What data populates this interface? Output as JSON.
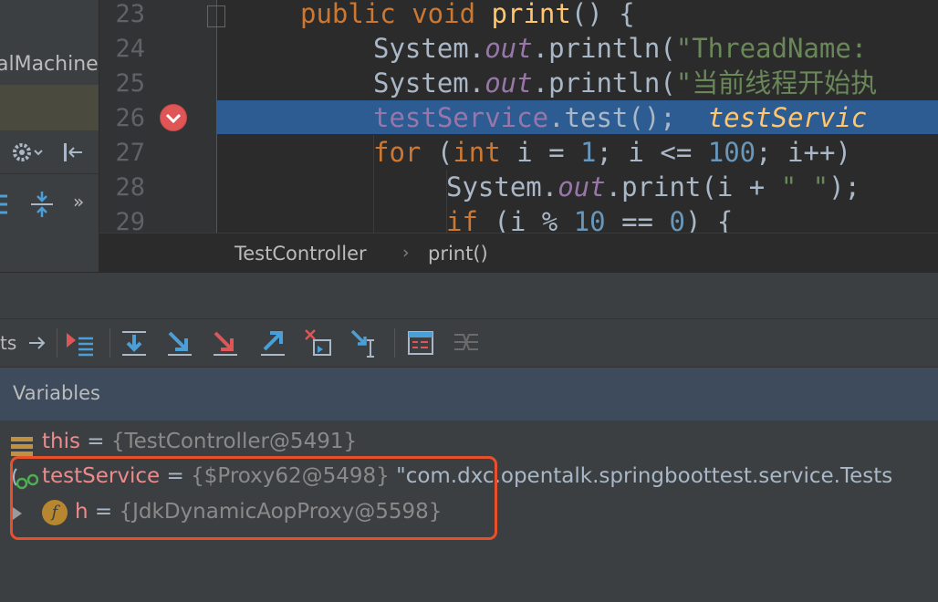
{
  "left_panel": {
    "label": "alMachine"
  },
  "editor": {
    "lines": [
      {
        "num": "23"
      },
      {
        "num": "24"
      },
      {
        "num": "25"
      },
      {
        "num": "26"
      },
      {
        "num": "27"
      },
      {
        "num": "28"
      },
      {
        "num": "29"
      }
    ],
    "code": {
      "l23_kw": "public void",
      "l23_fn": "print",
      "l23_rest": "() {",
      "l24_a": "System.",
      "l24_fld": "out",
      "l24_b": ".println(",
      "l24_str": "\"ThreadName:",
      "l25_a": "System.",
      "l25_fld": "out",
      "l25_b": ".println(",
      "l25_str": "\"当前线程开始执",
      "l26_fld": "testService",
      "l26_b": ".test();",
      "l26_inline": "testServic",
      "l27_kw": "for",
      "l27_a": "(",
      "l27_kw2": "int",
      "l27_b": "i =",
      "l27_n1": "1",
      "l27_c": "; i <=",
      "l27_n2": "100",
      "l27_d": "; i++)",
      "l28_a": "System.",
      "l28_fld": "out",
      "l28_b": ".print(i +",
      "l28_str": "\" \"",
      "l28_c": ");",
      "l29_kw": "if",
      "l29_a": "(i %",
      "l29_n1": "10",
      "l29_b": "==",
      "l29_n2": "0",
      "l29_c": ") {"
    },
    "breakpoint_color": "#e05555",
    "current_line_color": "#2d5c92"
  },
  "breadcrumb": {
    "class_name": "TestController",
    "separator": "›",
    "method_name": "print()"
  },
  "debug": {
    "toolbar_label": "ts",
    "toolbar_buttons": [
      "restore-layout-icon",
      "show-execution-point-icon",
      "step-over-icon",
      "step-into-icon",
      "force-step-into-icon",
      "step-out-icon",
      "drop-frame-icon",
      "run-to-cursor-icon",
      "evaluate-expression-icon",
      "trace-current-stream-icon"
    ],
    "variables_title": "Variables",
    "variables": [
      {
        "name": "this",
        "eq": "=",
        "type": "{TestController@5491}",
        "value": ""
      },
      {
        "name": "testService",
        "eq": "=",
        "type": "{$Proxy62@5498}",
        "value": "\"com.dxc.opentalk.springboottest.service.Tests"
      },
      {
        "name": "h",
        "eq": "=",
        "type": "{JdkDynamicAopProxy@5598}",
        "value": ""
      }
    ],
    "field_badge": "f",
    "highlight_color": "#e8502c"
  }
}
